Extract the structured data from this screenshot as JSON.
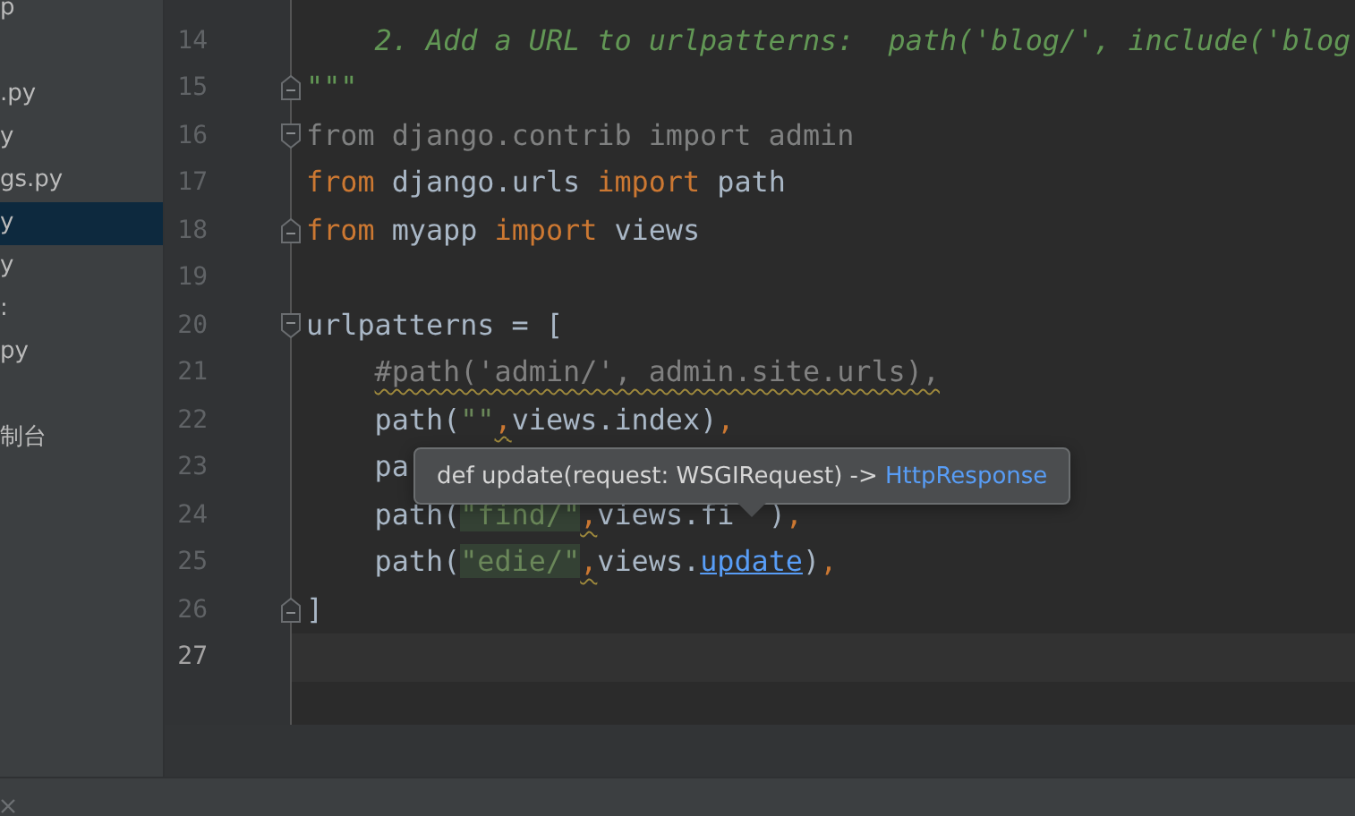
{
  "sidebar": {
    "items": [
      {
        "label": "p",
        "selected": false
      },
      {
        "label": ".py",
        "selected": false,
        "gap_before": true
      },
      {
        "label": "y",
        "selected": false
      },
      {
        "label": "gs.py",
        "selected": false
      },
      {
        "label": "y",
        "selected": true
      },
      {
        "label": "y",
        "selected": false
      },
      {
        "label": ":",
        "selected": false
      },
      {
        "label": "py",
        "selected": false
      },
      {
        "label": "制台",
        "selected": false,
        "gap_before": true
      }
    ]
  },
  "editor": {
    "lines": [
      {
        "number": "14",
        "tokens": [
          {
            "kind": "doc",
            "text": "    2. Add a URL to urlpatterns:  path('blog/', include('blog"
          }
        ]
      },
      {
        "number": "15",
        "fold_close": true,
        "tokens": [
          {
            "kind": "doc",
            "text": "\"\"\""
          }
        ]
      },
      {
        "number": "16",
        "fold_open": true,
        "tokens": [
          {
            "kind": "unused",
            "text": "from django.contrib import admin"
          }
        ]
      },
      {
        "number": "17",
        "tokens": [
          {
            "kind": "keyword",
            "text": "from "
          },
          {
            "kind": "plain",
            "text": "django.urls "
          },
          {
            "kind": "keyword",
            "text": "import "
          },
          {
            "kind": "plain",
            "text": "path"
          }
        ]
      },
      {
        "number": "18",
        "fold_close": true,
        "tokens": [
          {
            "kind": "keyword",
            "text": "from "
          },
          {
            "kind": "plain",
            "text": "myapp "
          },
          {
            "kind": "keyword",
            "text": "import "
          },
          {
            "kind": "plain",
            "text": "views"
          }
        ]
      },
      {
        "number": "19"
      },
      {
        "number": "20",
        "fold_open": true,
        "tokens": [
          {
            "kind": "plain",
            "text": "urlpatterns = ["
          }
        ]
      },
      {
        "number": "21",
        "tokens": [
          {
            "kind": "comment",
            "text": "    #path('admin/', admin.site.urls),",
            "warning": true
          }
        ]
      },
      {
        "number": "22",
        "tokens": [
          {
            "kind": "plain",
            "text": "    path("
          },
          {
            "kind": "string",
            "text": "\"\""
          },
          {
            "kind": "punct",
            "text": ",",
            "warning": true
          },
          {
            "kind": "plain",
            "text": "views.index)"
          },
          {
            "kind": "punct",
            "text": ","
          }
        ]
      },
      {
        "number": "23",
        "tokens": [
          {
            "kind": "plain",
            "text": "    pa"
          }
        ]
      },
      {
        "number": "24",
        "tokens": [
          {
            "kind": "plain",
            "text": "    path("
          },
          {
            "kind": "string",
            "text": "\"find/\"",
            "highlight": true
          },
          {
            "kind": "punct",
            "text": ",",
            "warning": true
          },
          {
            "kind": "plain",
            "text": "views.fi"
          },
          {
            "kind": "plain",
            "text": ")",
            "covered_before": true
          },
          {
            "kind": "punct",
            "text": ","
          }
        ]
      },
      {
        "number": "25",
        "tokens": [
          {
            "kind": "plain",
            "text": "    path("
          },
          {
            "kind": "string",
            "text": "\"edie/\"",
            "highlight": true
          },
          {
            "kind": "punct",
            "text": ",",
            "warning": true
          },
          {
            "kind": "plain",
            "text": "views."
          },
          {
            "kind": "link",
            "text": "update"
          },
          {
            "kind": "plain",
            "text": ")"
          },
          {
            "kind": "punct",
            "text": ","
          }
        ]
      },
      {
        "number": "26",
        "fold_close": true,
        "tokens": [
          {
            "kind": "plain",
            "text": "]"
          }
        ]
      },
      {
        "number": "27",
        "current": true
      }
    ],
    "tooltip": {
      "signature": "def update(request: WSGIRequest) -> ",
      "return_type": "HttpResponse"
    }
  }
}
